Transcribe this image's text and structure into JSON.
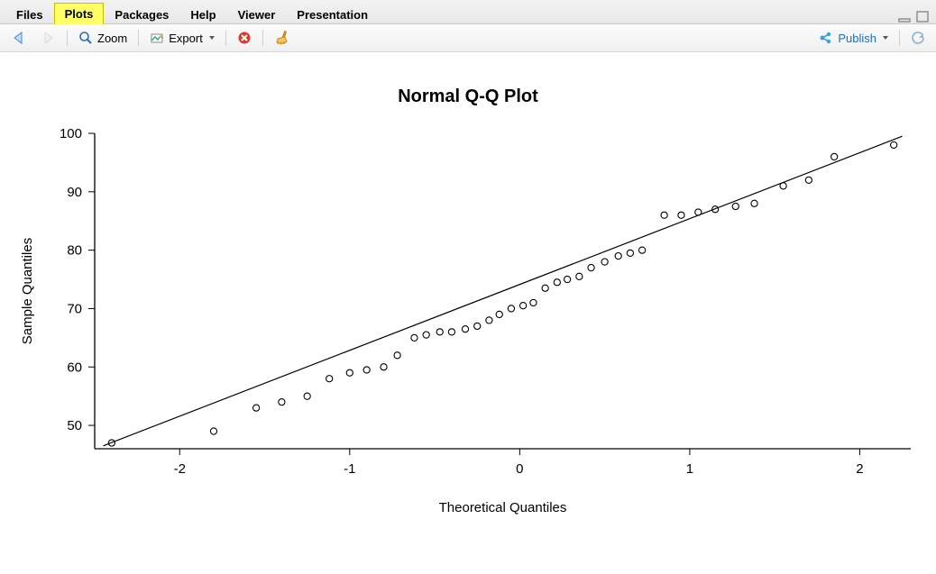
{
  "tabs": {
    "items": [
      "Files",
      "Plots",
      "Packages",
      "Help",
      "Viewer",
      "Presentation"
    ],
    "activeIndex": 1
  },
  "toolbar": {
    "zoom": "Zoom",
    "export": "Export",
    "publish": "Publish"
  },
  "chart_data": {
    "type": "scatter",
    "title": "Normal Q-Q Plot",
    "xlabel": "Theoretical Quantiles",
    "ylabel": "Sample Quantiles",
    "xlim": [
      -2.5,
      2.3
    ],
    "ylim": [
      46,
      100
    ],
    "xticks": [
      -2,
      -1,
      0,
      1,
      2
    ],
    "yticks": [
      50,
      60,
      70,
      80,
      90,
      100
    ],
    "reference_line": {
      "x1": -2.45,
      "y1": 46.5,
      "x2": 2.25,
      "y2": 99.5
    },
    "series": [
      {
        "name": "sample",
        "points": [
          {
            "x": -2.4,
            "y": 47.0
          },
          {
            "x": -1.8,
            "y": 49.0
          },
          {
            "x": -1.55,
            "y": 53.0
          },
          {
            "x": -1.4,
            "y": 54.0
          },
          {
            "x": -1.25,
            "y": 55.0
          },
          {
            "x": -1.12,
            "y": 58.0
          },
          {
            "x": -1.0,
            "y": 59.0
          },
          {
            "x": -0.9,
            "y": 59.5
          },
          {
            "x": -0.8,
            "y": 60.0
          },
          {
            "x": -0.72,
            "y": 62.0
          },
          {
            "x": -0.62,
            "y": 65.0
          },
          {
            "x": -0.55,
            "y": 65.5
          },
          {
            "x": -0.47,
            "y": 66.0
          },
          {
            "x": -0.4,
            "y": 66.0
          },
          {
            "x": -0.32,
            "y": 66.5
          },
          {
            "x": -0.25,
            "y": 67.0
          },
          {
            "x": -0.18,
            "y": 68.0
          },
          {
            "x": -0.12,
            "y": 69.0
          },
          {
            "x": -0.05,
            "y": 70.0
          },
          {
            "x": 0.02,
            "y": 70.5
          },
          {
            "x": 0.08,
            "y": 71.0
          },
          {
            "x": 0.15,
            "y": 73.5
          },
          {
            "x": 0.22,
            "y": 74.5
          },
          {
            "x": 0.28,
            "y": 75.0
          },
          {
            "x": 0.35,
            "y": 75.5
          },
          {
            "x": 0.42,
            "y": 77.0
          },
          {
            "x": 0.5,
            "y": 78.0
          },
          {
            "x": 0.58,
            "y": 79.0
          },
          {
            "x": 0.65,
            "y": 79.5
          },
          {
            "x": 0.72,
            "y": 80.0
          },
          {
            "x": 0.85,
            "y": 86.0
          },
          {
            "x": 0.95,
            "y": 86.0
          },
          {
            "x": 1.05,
            "y": 86.5
          },
          {
            "x": 1.15,
            "y": 87.0
          },
          {
            "x": 1.27,
            "y": 87.5
          },
          {
            "x": 1.38,
            "y": 88.0
          },
          {
            "x": 1.55,
            "y": 91.0
          },
          {
            "x": 1.7,
            "y": 92.0
          },
          {
            "x": 1.85,
            "y": 96.0
          },
          {
            "x": 2.2,
            "y": 98.0
          }
        ]
      }
    ]
  }
}
